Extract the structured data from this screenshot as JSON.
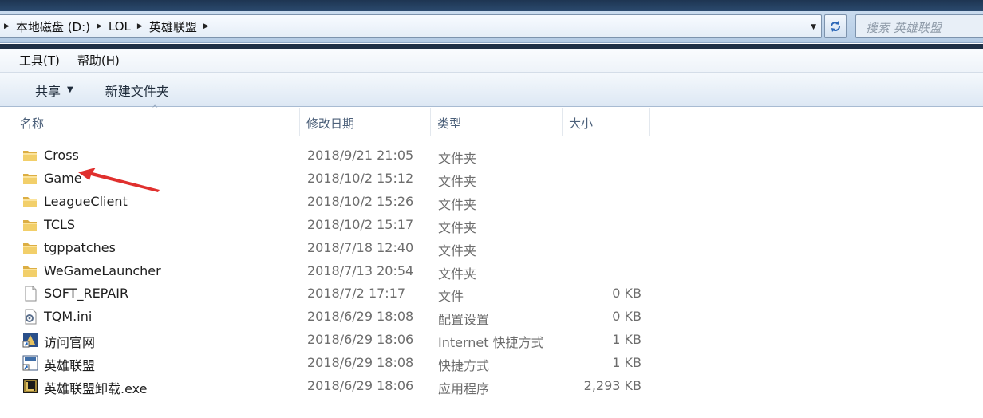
{
  "address": {
    "crumbs": [
      "本地磁盘 (D:)",
      "LOL",
      "英雄联盟"
    ],
    "search_placeholder": "搜索 英雄联盟"
  },
  "menu": {
    "items": [
      "工具(T)",
      "帮助(H)"
    ]
  },
  "toolbar": {
    "share_label": "共享",
    "new_folder_label": "新建文件夹"
  },
  "columns": {
    "name": "名称",
    "date": "修改日期",
    "type": "类型",
    "size": "大小"
  },
  "files": [
    {
      "name": "Cross",
      "date": "2018/9/21 21:05",
      "type": "文件夹",
      "size": "",
      "icon": "folder-icon"
    },
    {
      "name": "Game",
      "date": "2018/10/2 15:12",
      "type": "文件夹",
      "size": "",
      "icon": "folder-icon"
    },
    {
      "name": "LeagueClient",
      "date": "2018/10/2 15:26",
      "type": "文件夹",
      "size": "",
      "icon": "folder-icon"
    },
    {
      "name": "TCLS",
      "date": "2018/10/2 15:17",
      "type": "文件夹",
      "size": "",
      "icon": "folder-icon"
    },
    {
      "name": "tgppatches",
      "date": "2018/7/18 12:40",
      "type": "文件夹",
      "size": "",
      "icon": "folder-icon"
    },
    {
      "name": "WeGameLauncher",
      "date": "2018/7/13 20:54",
      "type": "文件夹",
      "size": "",
      "icon": "folder-icon"
    },
    {
      "name": "SOFT_REPAIR",
      "date": "2018/7/2 17:17",
      "type": "文件",
      "size": "0 KB",
      "icon": "blank-file-icon"
    },
    {
      "name": "TQM.ini",
      "date": "2018/6/29 18:08",
      "type": "配置设置",
      "size": "0 KB",
      "icon": "settings-file-icon"
    },
    {
      "name": "访问官网",
      "date": "2018/6/29 18:06",
      "type": "Internet 快捷方式",
      "size": "1 KB",
      "icon": "internet-shortcut-icon"
    },
    {
      "name": "英雄联盟",
      "date": "2018/6/29 18:08",
      "type": "快捷方式",
      "size": "1 KB",
      "icon": "shortcut-icon"
    },
    {
      "name": "英雄联盟卸载.exe",
      "date": "2018/6/29 18:06",
      "type": "应用程序",
      "size": "2,293 KB",
      "icon": "app-exe-icon"
    }
  ],
  "colors": {
    "arrow": "#e0302e",
    "folder": "#e8c25a",
    "title_dark": "#1f3046"
  }
}
